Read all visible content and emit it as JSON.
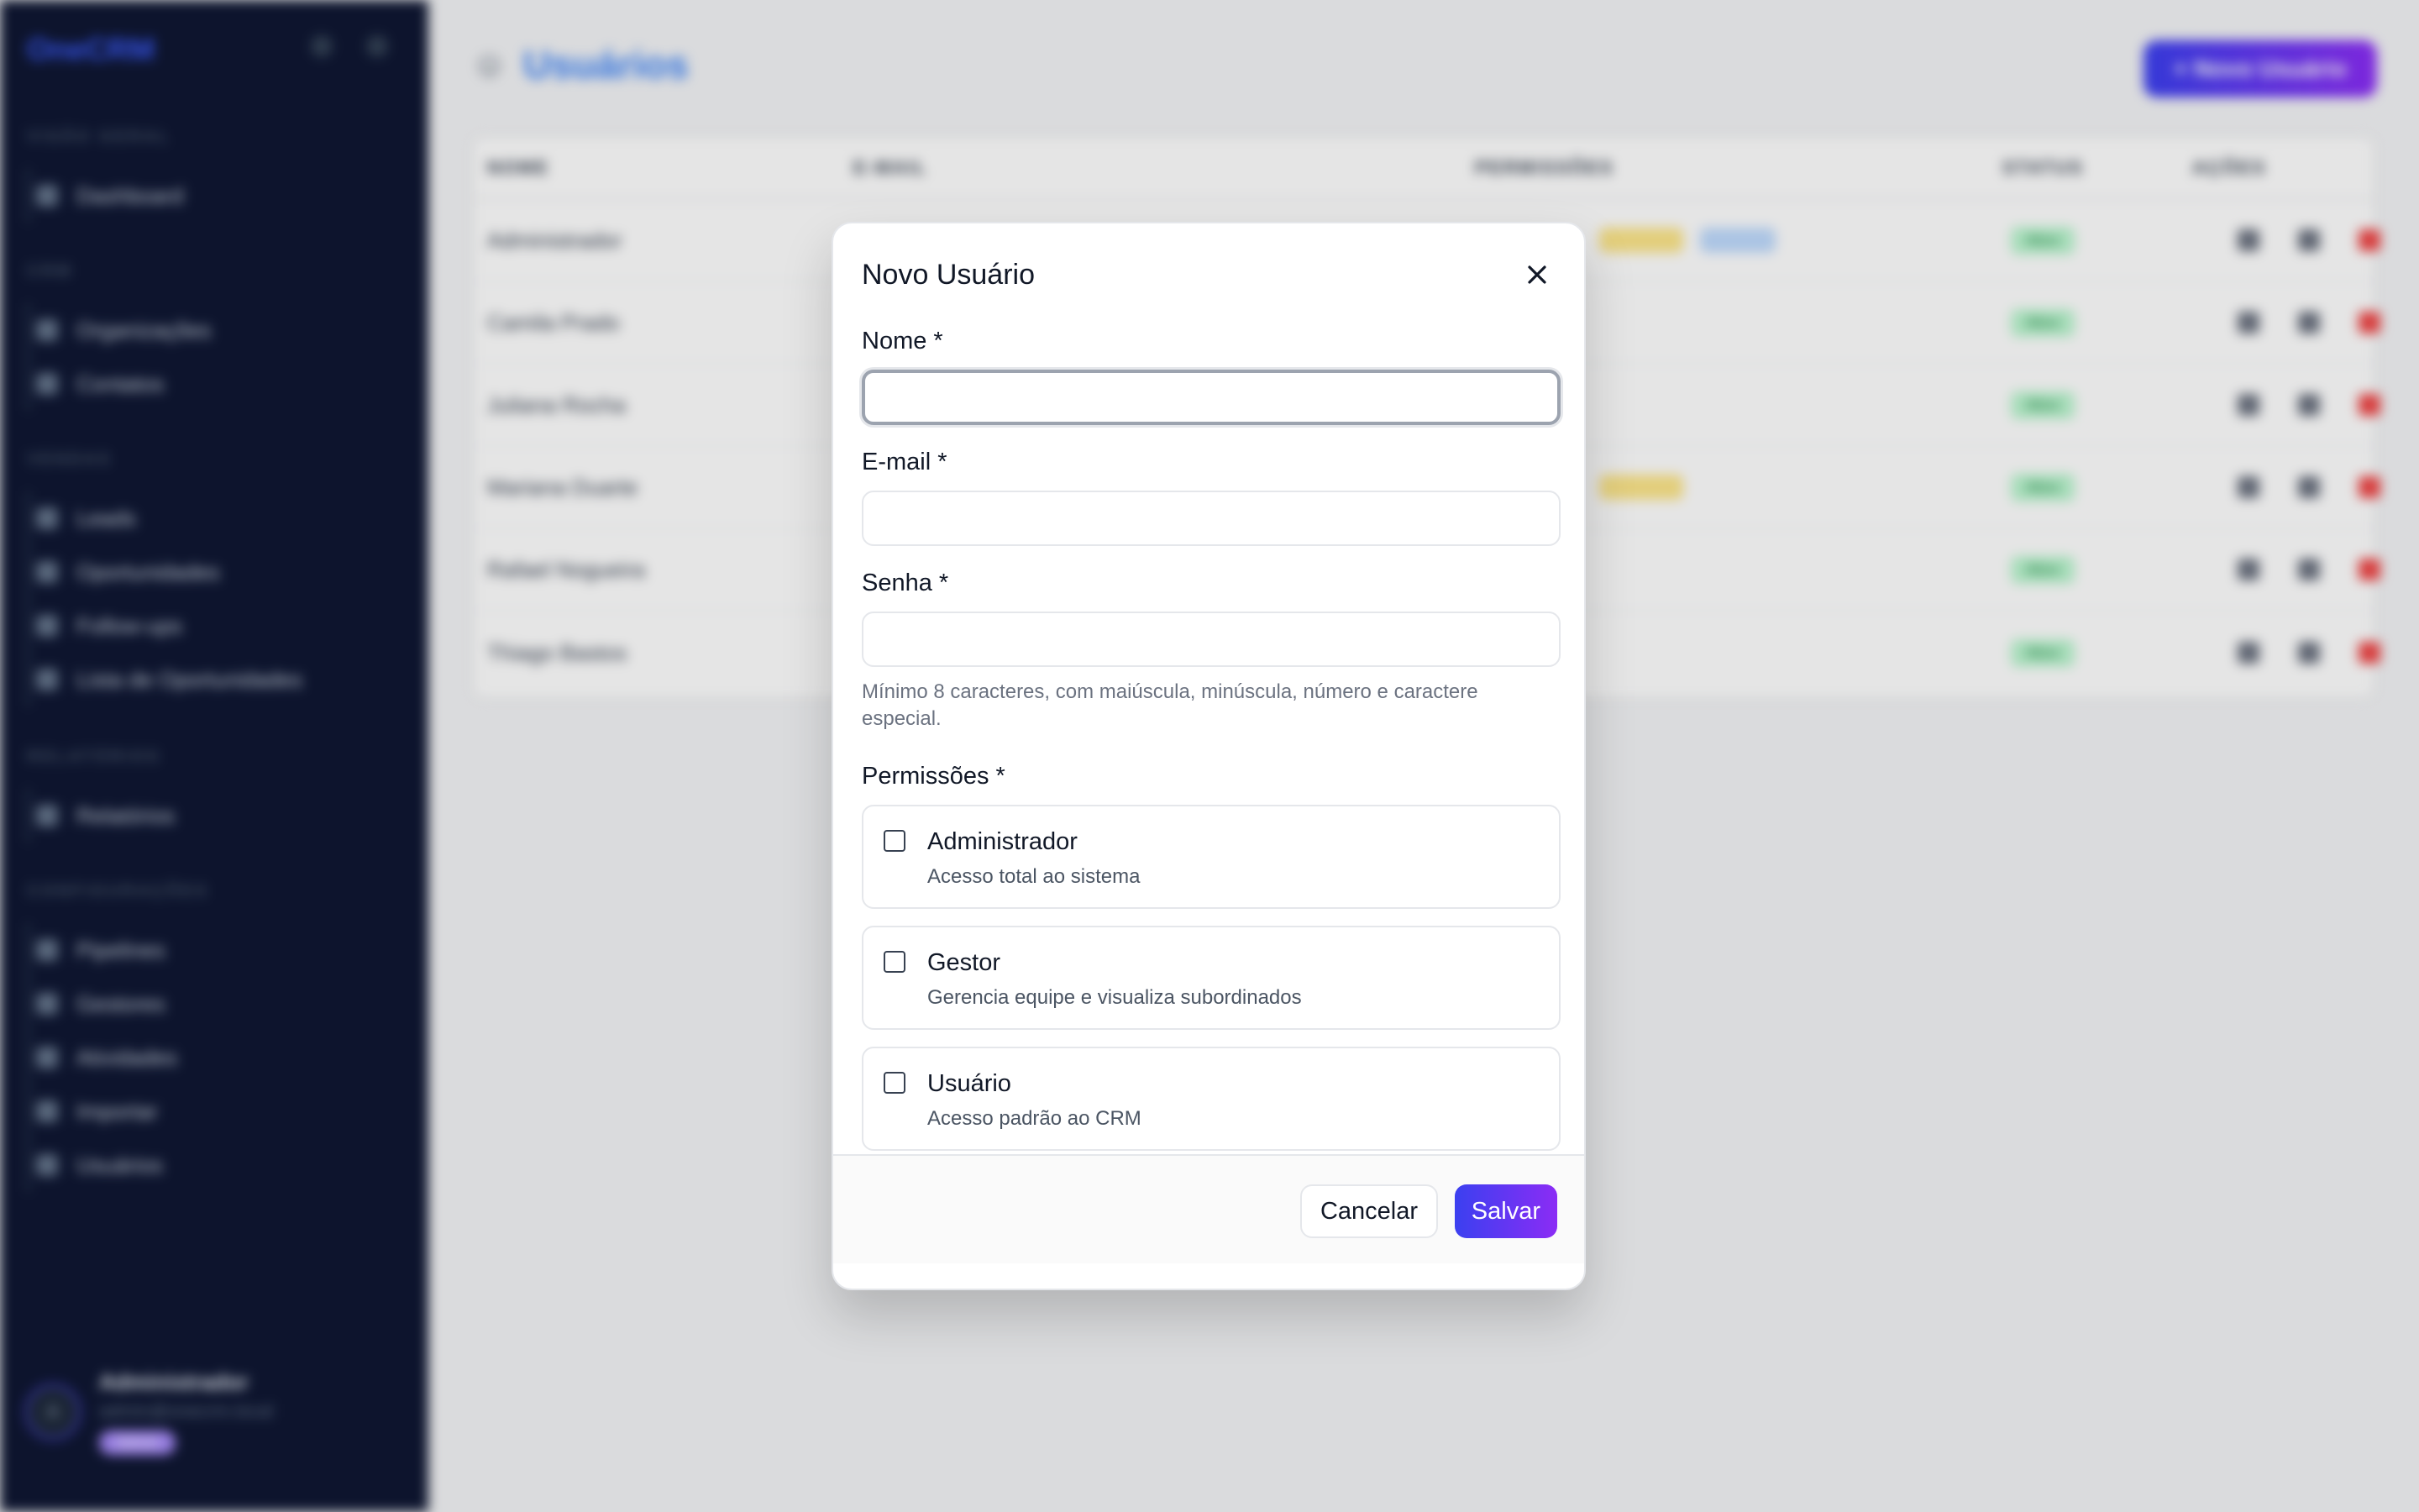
{
  "sidebar": {
    "brand": "OneCRM",
    "sections": [
      {
        "title": "Visão Geral",
        "items": [
          {
            "label": "Dashboard"
          }
        ]
      },
      {
        "title": "CRM",
        "items": [
          {
            "label": "Organizações"
          },
          {
            "label": "Contatos"
          }
        ]
      },
      {
        "title": "Vendas",
        "items": [
          {
            "label": "Leads"
          },
          {
            "label": "Oportunidades"
          },
          {
            "label": "Follow-ups"
          },
          {
            "label": "Lista de Oportunidades"
          }
        ]
      },
      {
        "title": "Relatórios",
        "items": [
          {
            "label": "Relatórios"
          }
        ]
      },
      {
        "title": "Configurações",
        "items": [
          {
            "label": "Pipelines"
          },
          {
            "label": "Gestores"
          },
          {
            "label": "Atividades"
          },
          {
            "label": "Importar"
          },
          {
            "label": "Usuários"
          }
        ]
      }
    ],
    "user": {
      "initial": "A",
      "name": "Administrador",
      "email": "admin@onecrm.local",
      "role": "Admin"
    }
  },
  "main": {
    "title": "Usuários",
    "title_icon": "users-icon",
    "new_button": "+ Novo Usuário",
    "columns": [
      "NOME",
      "E-MAIL",
      "PERMISSÕES",
      "STATUS",
      "AÇÕES"
    ],
    "rows": [
      {
        "name": "Administrador",
        "status": "Ativo"
      },
      {
        "name": "Camila Prado",
        "status": "Ativo"
      },
      {
        "name": "Juliana Rocha",
        "status": "Ativo"
      },
      {
        "name": "Mariana Duarte",
        "status": "Ativo"
      },
      {
        "name": "Rafael Nogueira",
        "status": "Ativo"
      },
      {
        "name": "Thiago Bastos",
        "status": "Ativo"
      }
    ]
  },
  "modal": {
    "title": "Novo Usuário",
    "close_icon": "close-icon",
    "fields": {
      "name": {
        "label": "Nome *",
        "value": ""
      },
      "email": {
        "label": "E-mail *",
        "value": ""
      },
      "password": {
        "label": "Senha *",
        "value": "",
        "hint": "Mínimo 8 caracteres, com maiúscula, minúscula, número e caractere especial."
      }
    },
    "permissions_label": "Permissões *",
    "permissions": [
      {
        "name": "Administrador",
        "description": "Acesso total ao sistema",
        "checked": false
      },
      {
        "name": "Gestor",
        "description": "Gerencia equipe e visualiza subordinados",
        "checked": false
      },
      {
        "name": "Usuário",
        "description": "Acesso padrão ao CRM",
        "checked": false
      }
    ],
    "cancel_label": "Cancelar",
    "save_label": "Salvar"
  },
  "colors": {
    "sidebar_bg": "#0f1733",
    "accent_gradient_start": "#3b40f0",
    "accent_gradient_end": "#8b2cf5",
    "status_active": "#bbf7d0"
  }
}
